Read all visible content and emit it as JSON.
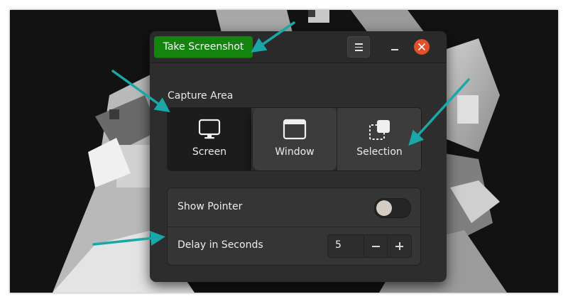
{
  "header": {
    "take_screenshot_label": "Take Screenshot",
    "menu_icon": "hamburger-menu-icon",
    "minimize_icon": "minimize-icon",
    "close_icon": "close-icon"
  },
  "capture": {
    "section_label": "Capture Area",
    "options": [
      {
        "label": "Screen",
        "icon": "monitor-icon",
        "selected": true
      },
      {
        "label": "Window",
        "icon": "window-icon",
        "selected": false
      },
      {
        "label": "Selection",
        "icon": "selection-icon",
        "selected": false
      }
    ]
  },
  "settings": {
    "show_pointer_label": "Show Pointer",
    "show_pointer_on": false,
    "delay_label": "Delay in Seconds",
    "delay_value": "5"
  },
  "colors": {
    "accent_green": "#13850f",
    "close_orange": "#e0502a",
    "annotation_teal": "#1aa7a8",
    "window_bg": "#2d2d2d"
  }
}
